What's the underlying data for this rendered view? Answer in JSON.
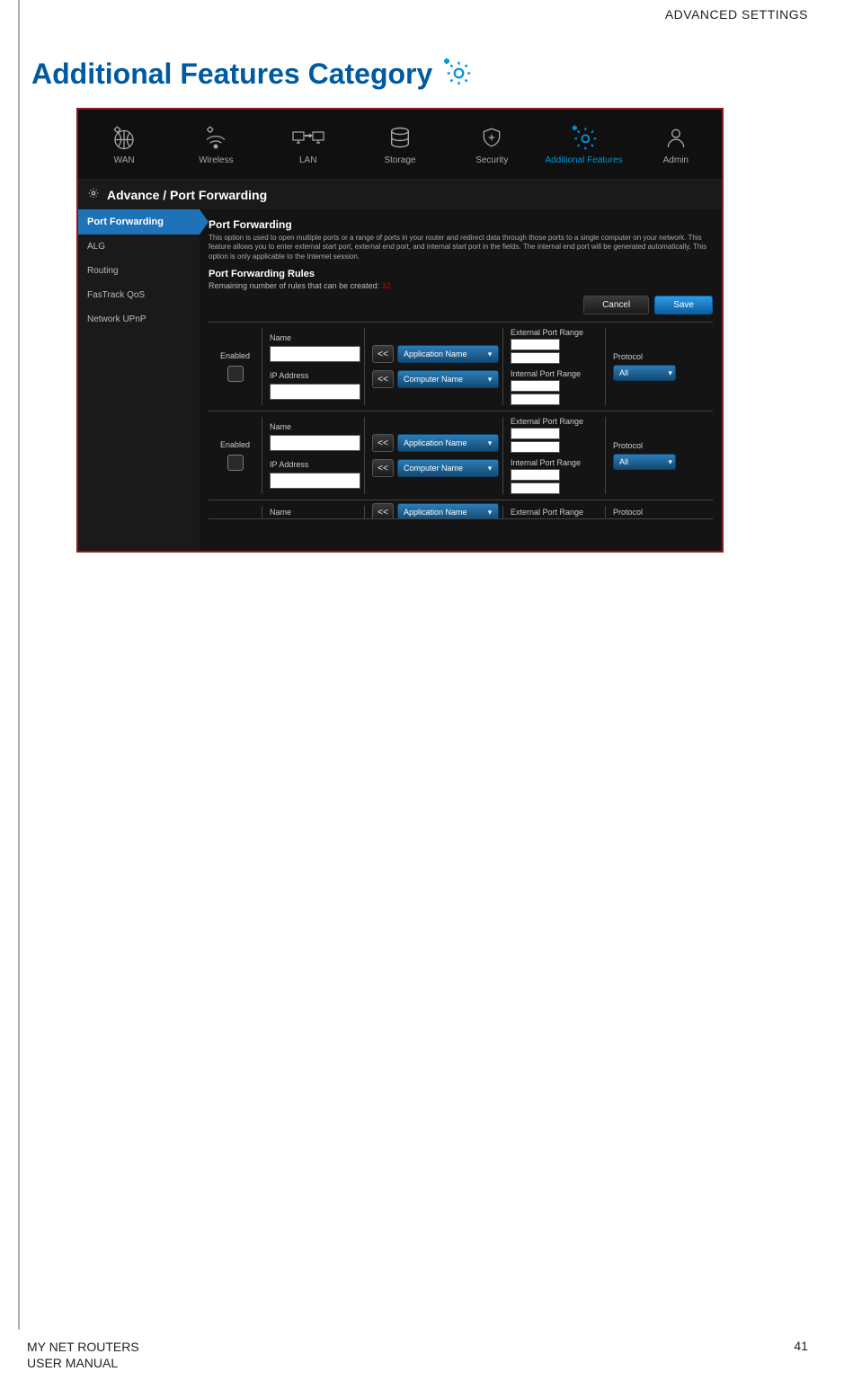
{
  "header": {
    "right": "ADVANCED SETTINGS"
  },
  "title": "Additional Features Category",
  "nav": {
    "items": [
      {
        "label": "WAN"
      },
      {
        "label": "Wireless"
      },
      {
        "label": "LAN"
      },
      {
        "label": "Storage"
      },
      {
        "label": "Security"
      },
      {
        "label": "Additional Features"
      },
      {
        "label": "Admin"
      }
    ]
  },
  "crumb": "Advance / Port Forwarding",
  "sidebar": {
    "items": [
      {
        "label": "Port Forwarding"
      },
      {
        "label": "ALG"
      },
      {
        "label": "Routing"
      },
      {
        "label": "FasTrack QoS"
      },
      {
        "label": "Network UPnP"
      }
    ]
  },
  "section": {
    "heading": "Port Forwarding",
    "desc": "This option is used to open multiple ports or a range of ports in your router and redirect data through those ports to a single computer on your network. This feature allows you to enter external start port, external end port, and internal start port in the fields. The internal end port will be generated automatically. This option is only applicable to the Internet session."
  },
  "rules": {
    "heading": "Port Forwarding Rules",
    "remain_prefix": "Remaining number of rules that can be created: ",
    "remain_value": "32"
  },
  "buttons": {
    "cancel": "Cancel",
    "save": "Save"
  },
  "fields": {
    "enabled": "Enabled",
    "name": "Name",
    "ip": "IP Address",
    "app": "Application Name",
    "computer": "Computer Name",
    "ext": "External Port Range",
    "int": "Internal Port Range",
    "protocol": "Protocol",
    "protocol_value": "All",
    "arrow": "<<"
  },
  "footer": {
    "line1": "MY NET ROUTERS",
    "line2": "USER MANUAL",
    "page": "41"
  }
}
